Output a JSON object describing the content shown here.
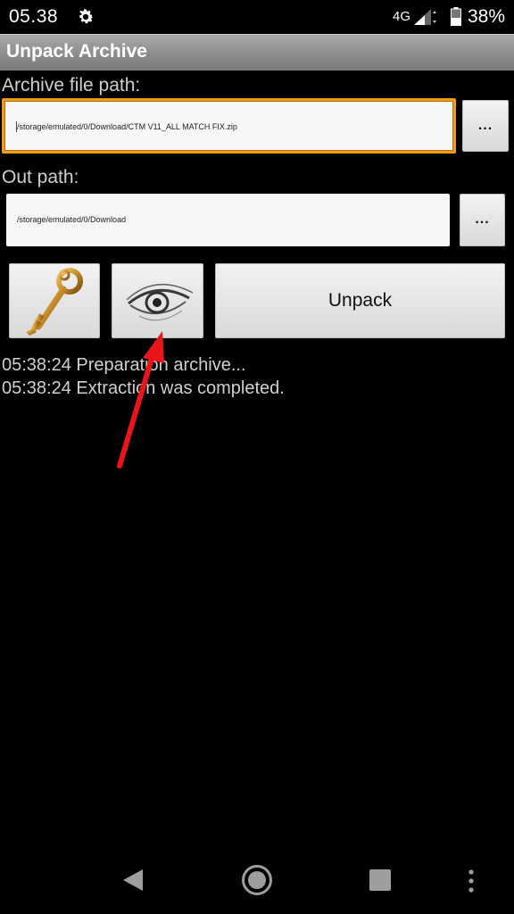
{
  "status_bar": {
    "time": "05.38",
    "network": "4G",
    "battery_percent": "38%",
    "icons": [
      "settings-gear-icon",
      "signal-icon",
      "battery-icon"
    ]
  },
  "app": {
    "title": "Unpack Archive"
  },
  "archive": {
    "label": "Archive file path:",
    "value": "/storage/emulated/0/Download/CTM V11_ALL MATCH FIX.zip",
    "browse_label": "..."
  },
  "out": {
    "label": "Out path:",
    "value": "/storage/emulated/0/Download",
    "browse_label": "..."
  },
  "actions": {
    "password_icon": "key-icon",
    "view_icon": "eye-icon",
    "unpack_label": "Unpack"
  },
  "log": [
    "05:38:24 Preparation archive...",
    "05:38:24 Extraction was completed."
  ],
  "annotation": {
    "arrow_color": "#e8151a"
  },
  "nav": {
    "icons": [
      "back-icon",
      "home-icon",
      "recents-icon",
      "menu-dots-icon"
    ]
  }
}
